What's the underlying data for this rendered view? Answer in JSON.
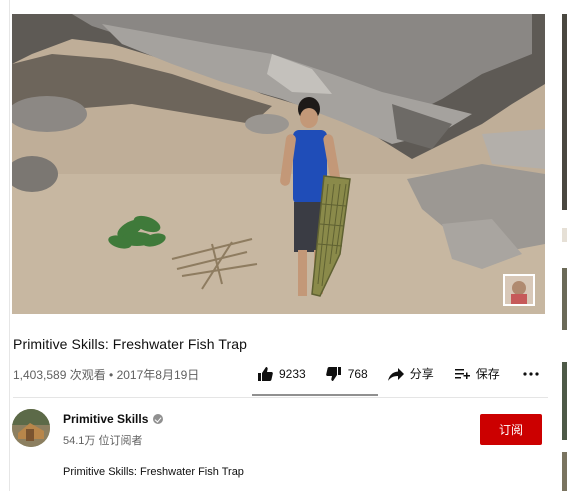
{
  "video": {
    "title": "Primitive Skills: Freshwater Fish Trap",
    "views_date": "1,403,589 次观看 • 2017年8月19日"
  },
  "actions": {
    "like_count": "9233",
    "dislike_count": "768",
    "share_label": "分享",
    "save_label": "保存",
    "like_ratio": 0.923
  },
  "channel": {
    "name": "Primitive Skills",
    "subscribers": "54.1万 位订阅者",
    "subscribe_label": "订阅"
  },
  "description": {
    "text": "Primitive Skills: Freshwater Fish Trap"
  },
  "icons": [
    "thumbs-up-icon",
    "thumbs-down-icon",
    "share-icon",
    "add-to-playlist-icon",
    "more-icon",
    "verified-icon"
  ],
  "colors": {
    "subscribe": "#cc0000",
    "secondary_text": "#606060"
  }
}
